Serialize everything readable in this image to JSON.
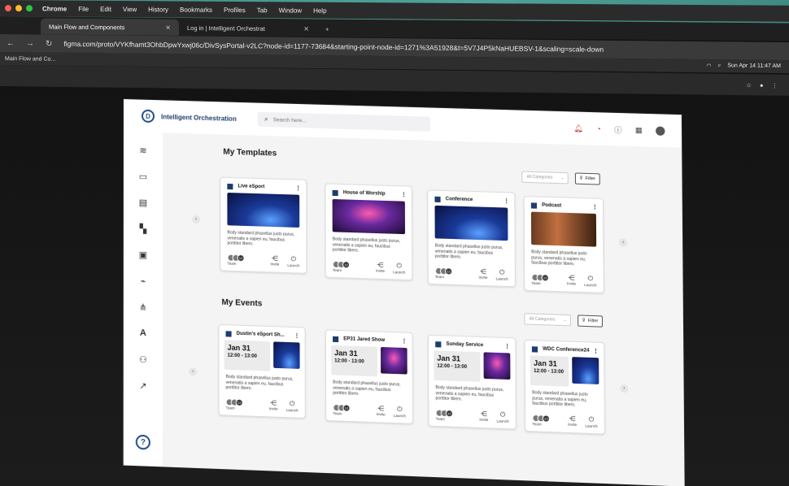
{
  "menubar": {
    "items": [
      "Chrome",
      "File",
      "Edit",
      "View",
      "History",
      "Bookmarks",
      "Profiles",
      "Tab",
      "Window",
      "Help"
    ]
  },
  "tabs": [
    {
      "label": "Main Flow and Components"
    },
    {
      "label": "Log in | Intelligent Orchestrat"
    }
  ],
  "address": {
    "url": "figma.com/proto/VYKfhamt3OhbDpwYxwj06c/DivSysPortal-v2LC?node-id=1177-73684&starting-point-node-id=1271%3A51928&t=5V7J4P5kNaHUEBSV-1&scaling=scale-down"
  },
  "bookmarkbar": {
    "label": "Main Flow and Co...",
    "clock": "Sun Apr 14  11:47 AM"
  },
  "app": {
    "name": "Intelligent Orchestration",
    "search_placeholder": "Search here...",
    "help": "?"
  },
  "templates": {
    "title": "My Templates",
    "category_placeholder": "All Categories",
    "filter_label": "Filter",
    "cards": [
      {
        "title": "Live eSport",
        "description": "Body standard phasellus justo purus, venenatis a sapien eu, faucibus porttitor libero.",
        "count": "12",
        "team": "Team",
        "invite": "Invite",
        "launch": "Launch"
      },
      {
        "title": "House of Worship",
        "description": "Body standard phasellus justo purus, venenatis a sapien eu, faucibus porttitor libero.",
        "count": "12",
        "team": "Team",
        "invite": "Invite",
        "launch": "Launch"
      },
      {
        "title": "Conference",
        "description": "Body standard phasellus justo purus, venenatis a sapien eu, faucibus porttitor libero.",
        "count": "12",
        "team": "Team",
        "invite": "Invite",
        "launch": "Launch"
      },
      {
        "title": "Podcast",
        "description": "Body standard phasellus justo purus, venenatis a sapien eu, faucibus porttitor libero.",
        "count": "12",
        "team": "Team",
        "invite": "Invite",
        "launch": "Launch"
      }
    ]
  },
  "events": {
    "title": "My Events",
    "category_placeholder": "All Categories",
    "filter_label": "Filter",
    "cards": [
      {
        "title": "Dustin's eSport Sh...",
        "date": "Jan 31",
        "time": "12:00 - 13:00",
        "description": "Body standard phasellus justo purus, venenatis a sapien eu, faucibus porttitor libero.",
        "count": "12",
        "team": "Team",
        "invite": "Invite",
        "launch": "Launch"
      },
      {
        "title": "EP31 Jared Show",
        "date": "Jan 31",
        "time": "12:00 - 13:00",
        "description": "Body standard phasellus justo purus, venenatis a sapien eu, faucibus porttitor libero.",
        "count": "12",
        "team": "Team",
        "invite": "Invite",
        "launch": "Launch"
      },
      {
        "title": "Sunday Service",
        "date": "Jan 31",
        "time": "12:00 - 13:00",
        "description": "Body standard phasellus justo purus, venenatis a sapien eu, faucibus porttitor libero.",
        "count": "12",
        "team": "Team",
        "invite": "Invite",
        "launch": "Launch"
      },
      {
        "title": "WDC Conference24",
        "date": "Jan 31",
        "time": "12:00 - 13:00",
        "description": "Body standard phasellus justo purus, venenatis a sapien eu, faucibus porttitor libero.",
        "count": "12",
        "team": "Team",
        "invite": "Invite",
        "launch": "Launch"
      }
    ]
  },
  "colors": {
    "brand": "#1e4e8c",
    "template_icon": "#1e3d6d"
  },
  "icons": {
    "sidebar": [
      "layers-icon",
      "printer-icon",
      "calendar-icon",
      "dashboard-icon",
      "devices-icon",
      "plug-icon",
      "workflow-icon",
      "text-icon",
      "team-icon",
      "analytics-icon"
    ]
  }
}
